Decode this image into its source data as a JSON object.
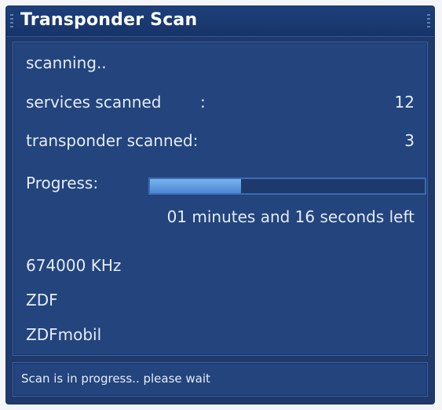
{
  "window": {
    "title": "Transponder Scan"
  },
  "scan": {
    "state_text": "scanning..",
    "services_label": "services scanned",
    "services_colon": ":",
    "services_value": "12",
    "transponder_label": "transponder scanned:",
    "transponder_value": "3",
    "progress_label": "Progress:",
    "progress_fraction": 0.33,
    "time_left": "01 minutes and 16 seconds left",
    "frequency": "674000 KHz",
    "provider": "ZDF",
    "service_name": "ZDFmobil"
  },
  "status": {
    "message": "Scan is in progress.. please wait"
  },
  "colors": {
    "background": "#1f3a6a",
    "panel": "#23447c",
    "progress_fill": "#5a95dc",
    "text": "#e4ecf8"
  }
}
